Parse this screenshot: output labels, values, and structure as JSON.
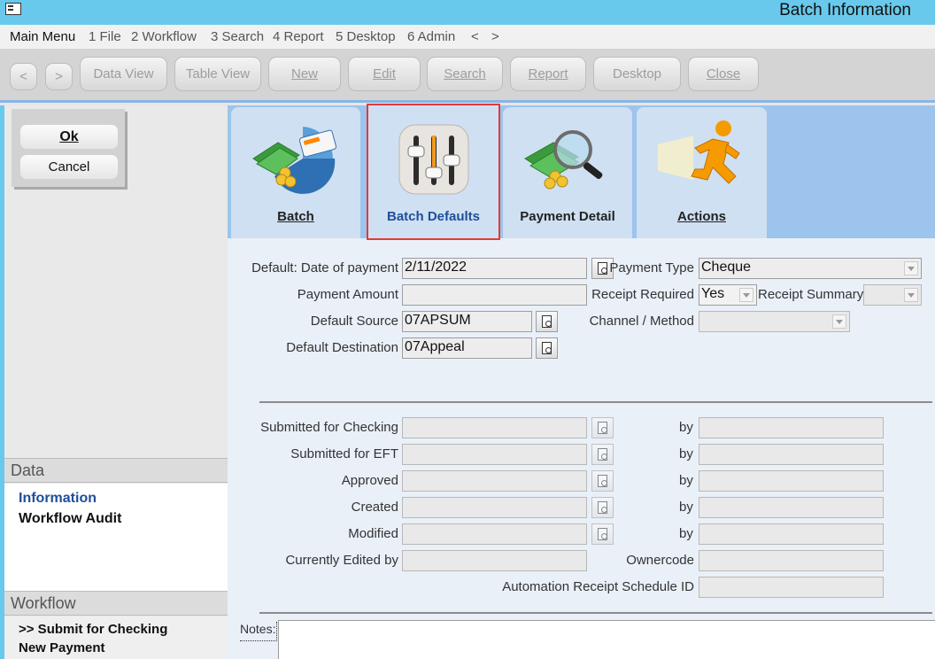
{
  "window": {
    "title": "Batch Information"
  },
  "menu": [
    "Main Menu",
    "1 File",
    "2 Workflow",
    "3 Search",
    "4 Report",
    "5 Desktop",
    "6 Admin",
    "<",
    ">"
  ],
  "toolbar": {
    "back": "<",
    "forward": ">",
    "data_view": "Data View",
    "table_view": "Table View",
    "new": "New",
    "edit": "Edit",
    "search": "Search",
    "report": "Report",
    "desktop": "Desktop",
    "close": "Close"
  },
  "actions": {
    "ok": "Ok",
    "cancel": "Cancel"
  },
  "data_section": {
    "title": "Data",
    "items": [
      "Information",
      "Workflow Audit"
    ]
  },
  "workflow_section": {
    "title": "Workflow",
    "items": [
      ">> Submit for Checking",
      "New Payment"
    ]
  },
  "tabs": [
    {
      "label": "Batch",
      "icon": "money-chart-icon"
    },
    {
      "label": "Batch Defaults",
      "icon": "sliders-icon",
      "selected": true
    },
    {
      "label": "Payment Detail",
      "icon": "money-magnifier-icon"
    },
    {
      "label": "Actions",
      "icon": "running-man-icon"
    }
  ],
  "form": {
    "date_of_payment": {
      "label": "Default: Date of payment",
      "value": "2/11/2022"
    },
    "payment_amount": {
      "label": "Payment Amount",
      "value": ""
    },
    "default_source": {
      "label": "Default Source",
      "value": "07APSUM"
    },
    "default_destination": {
      "label": "Default Destination",
      "value": "07Appeal"
    },
    "payment_type": {
      "label": "Payment Type",
      "value": "Cheque"
    },
    "receipt_required": {
      "label": "Receipt Required",
      "value": "Yes"
    },
    "receipt_summary": {
      "label": "Receipt Summary",
      "value": ""
    },
    "channel_method": {
      "label": "Channel / Method",
      "value": ""
    }
  },
  "audit": {
    "rows": [
      {
        "label": "Submitted for Checking",
        "value": "",
        "by": ""
      },
      {
        "label": "Submitted for EFT",
        "value": "",
        "by": ""
      },
      {
        "label": "Approved",
        "value": "",
        "by": ""
      },
      {
        "label": "Created",
        "value": "",
        "by": ""
      },
      {
        "label": "Modified",
        "value": "",
        "by": ""
      }
    ],
    "by_label": "by",
    "currently_edited_by": {
      "label": "Currently Edited by",
      "value": ""
    },
    "ownercode": {
      "label": "Ownercode",
      "value": ""
    },
    "automation_receipt_schedule_id": {
      "label": "Automation Receipt Schedule ID",
      "value": ""
    }
  },
  "notes": {
    "label": "Notes:",
    "value": ""
  },
  "colors": {
    "titlebar": "#68c9ec",
    "tabstrip": "#9cc4ec",
    "selected_tab_border": "#e53935",
    "link_blue": "#1e4e9a"
  }
}
